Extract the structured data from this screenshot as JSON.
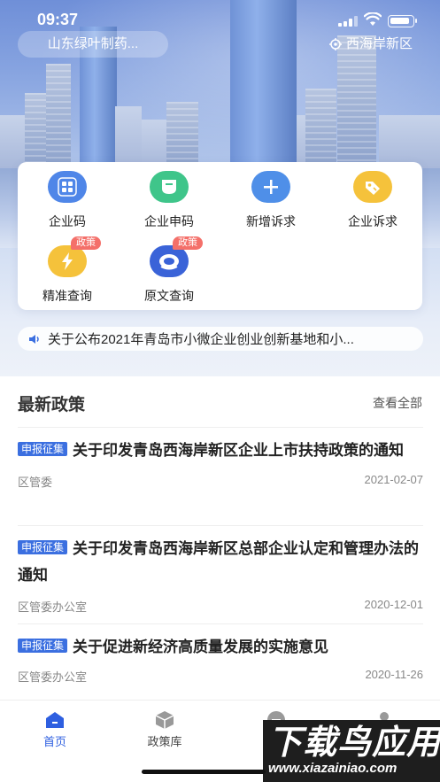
{
  "status_bar": {
    "time": "09:37"
  },
  "header": {
    "company": "山东绿叶制药...",
    "region": "西海岸新区"
  },
  "menu": [
    {
      "label": "企业码",
      "icon": "qr-grid-icon",
      "color": "#4f86e8",
      "badge": ""
    },
    {
      "label": "企业申码",
      "icon": "card-icon",
      "color": "#3fc58a",
      "badge": ""
    },
    {
      "label": "新增诉求",
      "icon": "plus-icon",
      "color": "#4f8fe8",
      "badge": ""
    },
    {
      "label": "企业诉求",
      "icon": "tag-icon",
      "color": "#f5c23b",
      "badge": ""
    },
    {
      "label": "精准查询",
      "icon": "lightning-icon",
      "color": "#f5c23b",
      "badge": "政策"
    },
    {
      "label": "原文查询",
      "icon": "document-ring-icon",
      "color": "#3a63d8",
      "badge": "政策"
    }
  ],
  "notice": {
    "text": "关于公布2021年青岛市小微企业创业创新基地和小..."
  },
  "latest": {
    "title": "最新政策",
    "see_all": "查看全部",
    "items": [
      {
        "tag": "申报征集",
        "title": "关于印发青岛西海岸新区企业上市扶持政策的通知",
        "source": "区管委",
        "date": "2021-02-07"
      },
      {
        "tag": "申报征集",
        "title": "关于印发青岛西海岸新区总部企业认定和管理办法的通知",
        "source": "区管委办公室",
        "date": "2020-12-01"
      },
      {
        "tag": "申报征集",
        "title": "关于促进新经济高质量发展的实施意见",
        "source": "区管委办公室",
        "date": "2020-11-26"
      }
    ]
  },
  "tabs": [
    {
      "label": "首页",
      "icon": "home-icon",
      "active": true
    },
    {
      "label": "政策库",
      "icon": "cube-icon",
      "active": false
    },
    {
      "label": "",
      "icon": "minus-circle-icon",
      "active": false
    },
    {
      "label": "",
      "icon": "user-icon",
      "active": false
    }
  ],
  "watermark": {
    "line1": "下载鸟应用",
    "line2": "www.xiazainiao.com"
  },
  "colors": {
    "primary": "#2e5fe0",
    "tag": "#3b6fe0",
    "badge": "#f4706a"
  }
}
